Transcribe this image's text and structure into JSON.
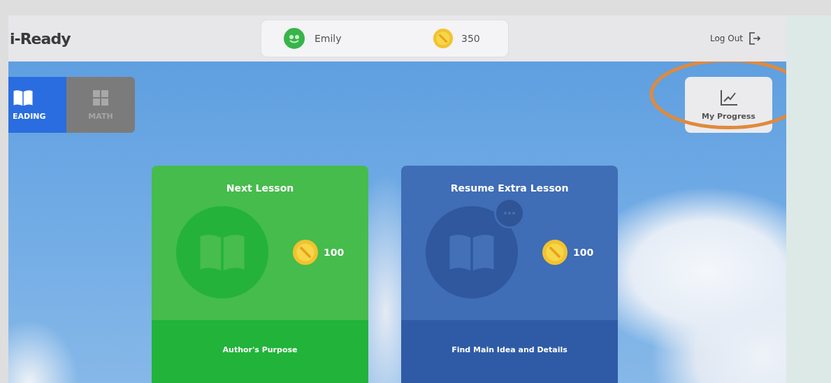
{
  "header": {
    "logo": "i-Ready",
    "user": {
      "name": "Emily",
      "coins": "350"
    },
    "logout": "Log Out"
  },
  "subjects": [
    {
      "label": "EADING",
      "kind": "reading",
      "selected": true
    },
    {
      "label": "MATH",
      "kind": "math",
      "selected": false
    }
  ],
  "progress_button": {
    "label": "My Progress"
  },
  "lessons": [
    {
      "kind": "next",
      "title": "Next Lesson",
      "coins": "100",
      "topic": "Author's Purpose",
      "in_progress": false
    },
    {
      "kind": "resume",
      "title": "Resume Extra Lesson",
      "coins": "100",
      "topic": "Find Main Idea and Details",
      "in_progress": true
    }
  ]
}
